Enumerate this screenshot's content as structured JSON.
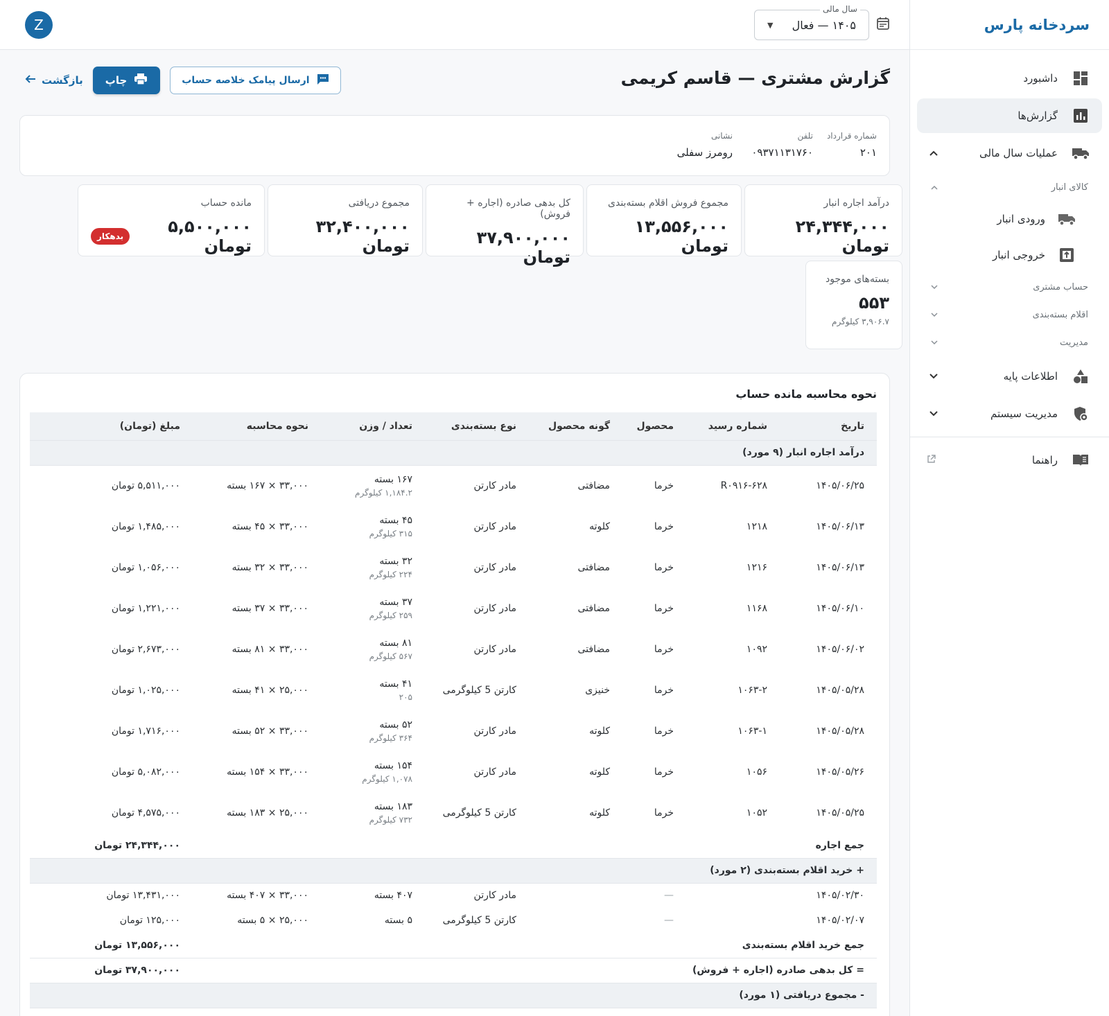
{
  "brand": "سردخانه پارس",
  "nav": {
    "dashboard": "داشبورد",
    "reports": "گزارش‌ها",
    "fiscal_ops": "عملیات سال مالی",
    "warehouse_goods": "کالای انبار",
    "warehouse_in": "ورودی انبار",
    "warehouse_out": "خروجی انبار",
    "customer_account": "حساب مشتری",
    "packaging_items": "اقلام بسته‌بندی",
    "management": "مدیریت",
    "base_info": "اطلاعات پایه",
    "system_admin": "مدیریت سیستم",
    "guide": "راهنما"
  },
  "header": {
    "fiscal_year_label": "سال مالی",
    "fiscal_year_value": "۱۴۰۵ — فعال",
    "avatar_letter": "Z"
  },
  "page": {
    "title": "گزارش مشتری — قاسم کریمی",
    "sms_button": "ارسال پیامک خلاصه حساب",
    "print_button": "چاپ",
    "back_link": "بازگشت"
  },
  "customer": {
    "contract_label": "شماره قرارداد",
    "contract_value": "۲۰۱",
    "phone_label": "تلفن",
    "phone_value": "۰۹۳۷۱۱۳۱۷۶۰",
    "address_label": "نشانی",
    "address_value": "رومرز سفلی"
  },
  "stats": {
    "rent_income_label": "درآمد اجاره انبار",
    "rent_income_value": "۲۴,۳۴۴,۰۰۰ تومان",
    "packaging_sales_label": "مجموع فروش اقلام بسته‌بندی",
    "packaging_sales_value": "۱۳,۵۵۶,۰۰۰ تومان",
    "total_debit_label": "کل بدهی صادره (اجاره + فروش)",
    "total_debit_value": "۳۷,۹۰۰,۰۰۰ تومان",
    "received_label": "مجموع دریافتی",
    "received_value": "۳۲,۴۰۰,۰۰۰ تومان",
    "balance_label": "مانده حساب",
    "balance_value": "۵,۵۰۰,۰۰۰ تومان",
    "balance_badge": "بدهکار",
    "packages_label": "بسته‌های موجود",
    "packages_value": "۵۵۳",
    "packages_weight": "۳,۹۰۶.۷ کیلوگرم"
  },
  "calc": {
    "title": "نحوه محاسبه مانده حساب",
    "headers": {
      "date": "تاریخ",
      "receipt": "شماره رسید",
      "product": "محصول",
      "variety": "گونه محصول",
      "package_type": "نوع بسته‌بندی",
      "qty": "تعداد / وزن",
      "method": "نحوه محاسبه",
      "amount": "مبلغ (تومان)"
    },
    "rent_section": "درآمد اجاره انبار (۹ مورد)",
    "rent_rows": [
      {
        "date": "۱۴۰۵/۰۶/۲۵",
        "receipt": "R۰۹۱۶-۶۲۸",
        "product": "خرما",
        "variety": "مضافتی",
        "package": "مادر کارتن",
        "qty": "۱۶۷ بسته",
        "weight": "۱,۱۸۴.۲ کیلوگرم",
        "method": "۳۳,۰۰۰ × ۱۶۷ بسته",
        "amount": "۵,۵۱۱,۰۰۰ تومان"
      },
      {
        "date": "۱۴۰۵/۰۶/۱۳",
        "receipt": "۱۲۱۸",
        "product": "خرما",
        "variety": "کلوته",
        "package": "مادر کارتن",
        "qty": "۴۵ بسته",
        "weight": "۳۱۵ کیلوگرم",
        "method": "۳۳,۰۰۰ × ۴۵ بسته",
        "amount": "۱,۴۸۵,۰۰۰ تومان"
      },
      {
        "date": "۱۴۰۵/۰۶/۱۳",
        "receipt": "۱۲۱۶",
        "product": "خرما",
        "variety": "مضافتی",
        "package": "مادر کارتن",
        "qty": "۳۲ بسته",
        "weight": "۲۲۴ کیلوگرم",
        "method": "۳۳,۰۰۰ × ۳۲ بسته",
        "amount": "۱,۰۵۶,۰۰۰ تومان"
      },
      {
        "date": "۱۴۰۵/۰۶/۱۰",
        "receipt": "۱۱۶۸",
        "product": "خرما",
        "variety": "مضافتی",
        "package": "مادر کارتن",
        "qty": "۳۷ بسته",
        "weight": "۲۵۹ کیلوگرم",
        "method": "۳۳,۰۰۰ × ۳۷ بسته",
        "amount": "۱,۲۲۱,۰۰۰ تومان"
      },
      {
        "date": "۱۴۰۵/۰۶/۰۲",
        "receipt": "۱۰۹۲",
        "product": "خرما",
        "variety": "مضافتی",
        "package": "مادر کارتن",
        "qty": "۸۱ بسته",
        "weight": "۵۶۷ کیلوگرم",
        "method": "۳۳,۰۰۰ × ۸۱ بسته",
        "amount": "۲,۶۷۳,۰۰۰ تومان"
      },
      {
        "date": "۱۴۰۵/۰۵/۲۸",
        "receipt": "۱۰۶۳-۲",
        "product": "خرما",
        "variety": "خنیزی",
        "package": "کارتن 5 کیلوگرمی",
        "qty": "۴۱ بسته",
        "weight": "۲۰۵",
        "method": "۲۵,۰۰۰ × ۴۱ بسته",
        "amount": "۱,۰۲۵,۰۰۰ تومان"
      },
      {
        "date": "۱۴۰۵/۰۵/۲۸",
        "receipt": "۱۰۶۳-۱",
        "product": "خرما",
        "variety": "کلوته",
        "package": "مادر کارتن",
        "qty": "۵۲ بسته",
        "weight": "۳۶۴ کیلوگرم",
        "method": "۳۳,۰۰۰ × ۵۲ بسته",
        "amount": "۱,۷۱۶,۰۰۰ تومان"
      },
      {
        "date": "۱۴۰۵/۰۵/۲۶",
        "receipt": "۱۰۵۶",
        "product": "خرما",
        "variety": "کلوته",
        "package": "مادر کارتن",
        "qty": "۱۵۴ بسته",
        "weight": "۱,۰۷۸ کیلوگرم",
        "method": "۳۳,۰۰۰ × ۱۵۴ بسته",
        "amount": "۵,۰۸۲,۰۰۰ تومان"
      },
      {
        "date": "۱۴۰۵/۰۵/۲۵",
        "receipt": "۱۰۵۲",
        "product": "خرما",
        "variety": "کلوته",
        "package": "کارتن 5 کیلوگرمی",
        "qty": "۱۸۳ بسته",
        "weight": "۷۳۲ کیلوگرم",
        "method": "۲۵,۰۰۰ × ۱۸۳ بسته",
        "amount": "۴,۵۷۵,۰۰۰ تومان"
      }
    ],
    "rent_total_label": "جمع اجاره",
    "rent_total_value": "۲۴,۳۴۴,۰۰۰ تومان",
    "packaging_section": "+ خرید اقلام بسته‌بندی (۲ مورد)",
    "packaging_rows": [
      {
        "date": "۱۴۰۵/۰۲/۳۰",
        "receipt": "—",
        "package": "مادر کارتن",
        "qty": "۴۰۷ بسته",
        "method": "۳۳,۰۰۰ × ۴۰۷ بسته",
        "amount": "۱۳,۴۳۱,۰۰۰ تومان"
      },
      {
        "date": "۱۴۰۵/۰۲/۰۷",
        "receipt": "—",
        "package": "کارتن 5 کیلوگرمی",
        "qty": "۵ بسته",
        "method": "۲۵,۰۰۰ × ۵ بسته",
        "amount": "۱۲۵,۰۰۰ تومان"
      }
    ],
    "packaging_total_label": "جمع خرید اقلام بسته‌بندی",
    "packaging_total_value": "۱۳,۵۵۶,۰۰۰ تومان",
    "debit_total_label": "= کل بدهی صادره (اجاره + فروش)",
    "debit_total_value": "۳۷,۹۰۰,۰۰۰ تومان",
    "received_section": "- مجموع دریافتی (۱ مورد)"
  },
  "colors": {
    "brand_blue": "#1a6aa6",
    "debtor_red": "#d32f2f",
    "table_header_bg": "#eef1f4"
  }
}
